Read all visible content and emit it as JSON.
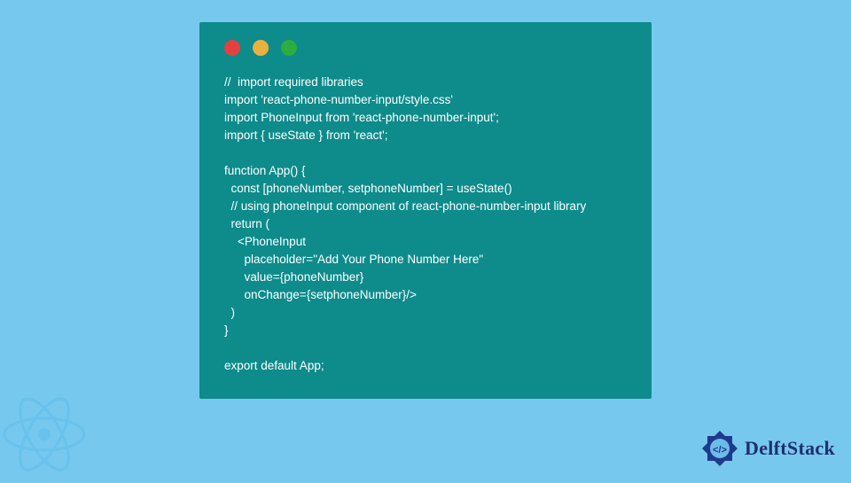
{
  "window": {
    "traffic_colors": {
      "red": "#e34140",
      "yellow": "#eab13e",
      "green": "#2aae3f"
    }
  },
  "code": {
    "lines": [
      "//  import required libraries",
      "import 'react-phone-number-input/style.css'",
      "import PhoneInput from 'react-phone-number-input';",
      "import { useState } from 'react';",
      "",
      "function App() {",
      "  const [phoneNumber, setphoneNumber] = useState()",
      "  // using phoneInput component of react-phone-number-input library",
      "  return (",
      "    <PhoneInput",
      "      placeholder=\"Add Your Phone Number Here\"",
      "      value={phoneNumber}",
      "      onChange={setphoneNumber}/>",
      "  )",
      "}",
      "",
      "export default App;"
    ]
  },
  "brand": {
    "name": "DelftStack",
    "logo_color": "#1f3a8a"
  }
}
